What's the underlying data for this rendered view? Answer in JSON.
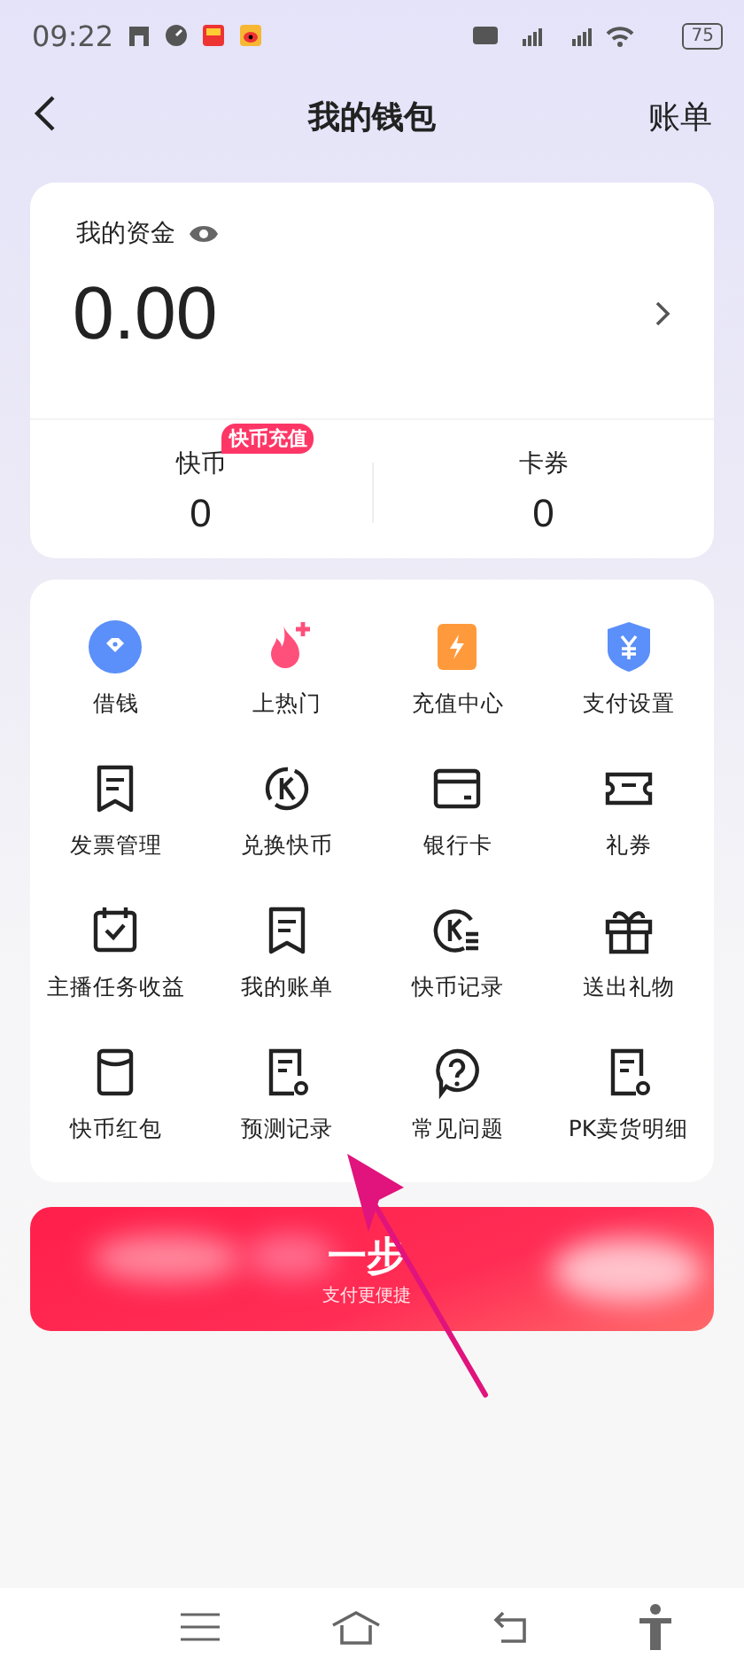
{
  "status_bar": {
    "time": "09:22",
    "battery": "75"
  },
  "header": {
    "title": "我的钱包",
    "action": "账单"
  },
  "funds": {
    "label": "我的资金",
    "amount": "0.00",
    "balances": [
      {
        "label": "快币",
        "value": "0",
        "badge": "快币充值"
      },
      {
        "label": "卡券",
        "value": "0"
      }
    ]
  },
  "services": [
    {
      "label": "借钱"
    },
    {
      "label": "上热门"
    },
    {
      "label": "充值中心"
    },
    {
      "label": "支付设置"
    },
    {
      "label": "发票管理"
    },
    {
      "label": "兑换快币"
    },
    {
      "label": "银行卡"
    },
    {
      "label": "礼券"
    },
    {
      "label": "主播任务收益"
    },
    {
      "label": "我的账单"
    },
    {
      "label": "快币记录"
    },
    {
      "label": "送出礼物"
    },
    {
      "label": "快币红包"
    },
    {
      "label": "预测记录"
    },
    {
      "label": "常见问题"
    },
    {
      "label": "PK卖货明细"
    }
  ],
  "banner": {
    "title": "一步",
    "subtitle": "支付更便捷"
  }
}
